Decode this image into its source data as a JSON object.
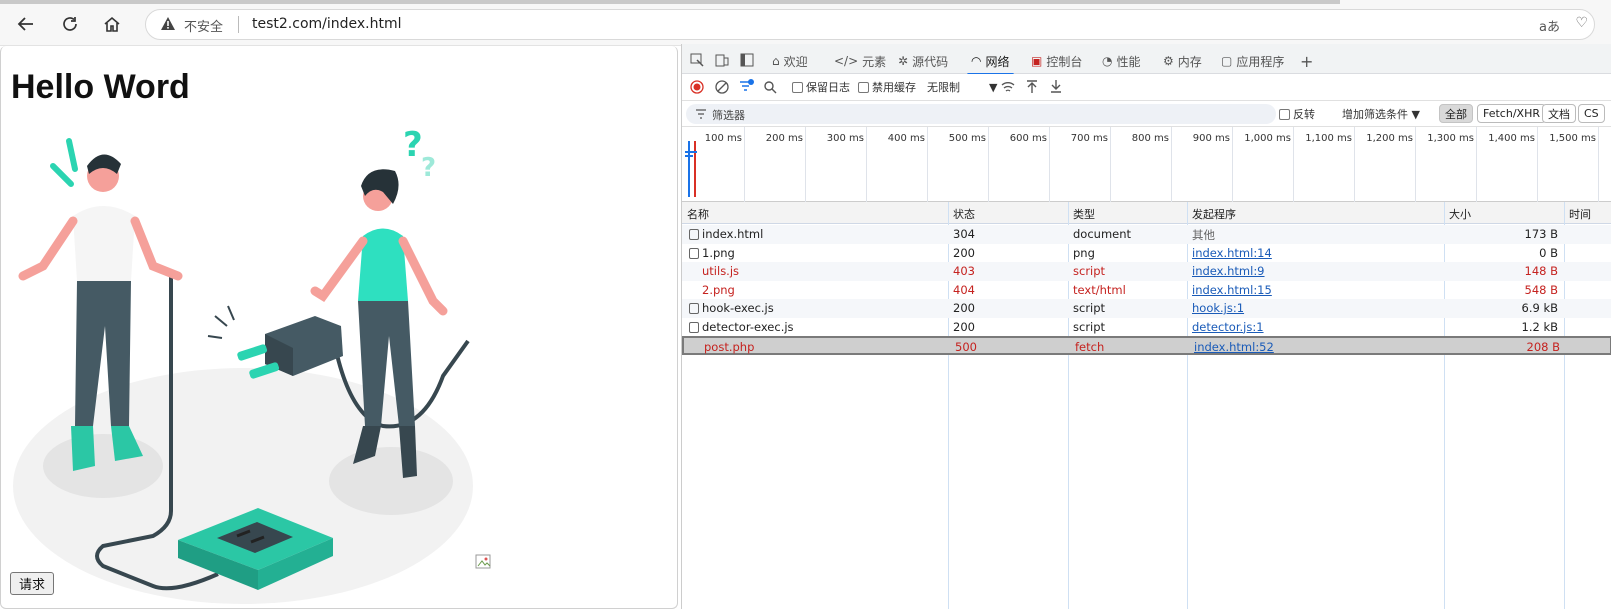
{
  "browser": {
    "insecure_label": "不安全",
    "url": "test2.com/index.html",
    "reader_label": "aあ"
  },
  "page": {
    "heading": "Hello Word",
    "request_button": "请求"
  },
  "devtools": {
    "tabs": [
      {
        "label": "欢迎",
        "icon": "home-icon"
      },
      {
        "label": "元素",
        "icon": "code-icon"
      },
      {
        "label": "源代码",
        "icon": "bug-icon"
      },
      {
        "label": "网络",
        "icon": "wifi-icon",
        "active": true
      },
      {
        "label": "控制台",
        "icon": "console-icon"
      },
      {
        "label": "性能",
        "icon": "gauge-icon"
      },
      {
        "label": "内存",
        "icon": "chip-icon"
      },
      {
        "label": "应用程序",
        "icon": "app-icon"
      }
    ],
    "toolbar": {
      "preserve_log": "保留日志",
      "disable_cache": "禁用缓存",
      "throttle": "无限制"
    },
    "filter": {
      "placeholder": "筛选器",
      "invert": "反转",
      "more_filters": "增加筛选条件",
      "chips": [
        "全部",
        "Fetch/XHR",
        "文档",
        "CS"
      ]
    },
    "timeline_ticks": [
      "100 ms",
      "200 ms",
      "300 ms",
      "400 ms",
      "500 ms",
      "600 ms",
      "700 ms",
      "800 ms",
      "900 ms",
      "1,000 ms",
      "1,100 ms",
      "1,200 ms",
      "1,300 ms",
      "1,400 ms",
      "1,500 ms"
    ],
    "columns": [
      "名称",
      "状态",
      "类型",
      "发起程序",
      "大小",
      "时间"
    ],
    "requests": [
      {
        "name": "index.html",
        "status": "304",
        "type": "document",
        "initiator": "其他",
        "size": "173 B",
        "error": false,
        "initiator_link": false
      },
      {
        "name": "1.png",
        "status": "200",
        "type": "png",
        "initiator": "index.html:14",
        "size": "0 B",
        "error": false,
        "initiator_link": true
      },
      {
        "name": "utils.js",
        "status": "403",
        "type": "script",
        "initiator": "index.html:9",
        "size": "148 B",
        "error": true,
        "initiator_link": true
      },
      {
        "name": "2.png",
        "status": "404",
        "type": "text/html",
        "initiator": "index.html:15",
        "size": "548 B",
        "error": true,
        "initiator_link": true
      },
      {
        "name": "hook-exec.js",
        "status": "200",
        "type": "script",
        "initiator": "hook.js:1",
        "size": "6.9 kB",
        "error": false,
        "initiator_link": true
      },
      {
        "name": "detector-exec.js",
        "status": "200",
        "type": "script",
        "initiator": "detector.js:1",
        "size": "1.2 kB",
        "error": false,
        "initiator_link": true
      },
      {
        "name": "post.php",
        "status": "500",
        "type": "fetch",
        "initiator": "index.html:52",
        "size": "208 B",
        "error": true,
        "initiator_link": true,
        "selected": true
      }
    ]
  }
}
